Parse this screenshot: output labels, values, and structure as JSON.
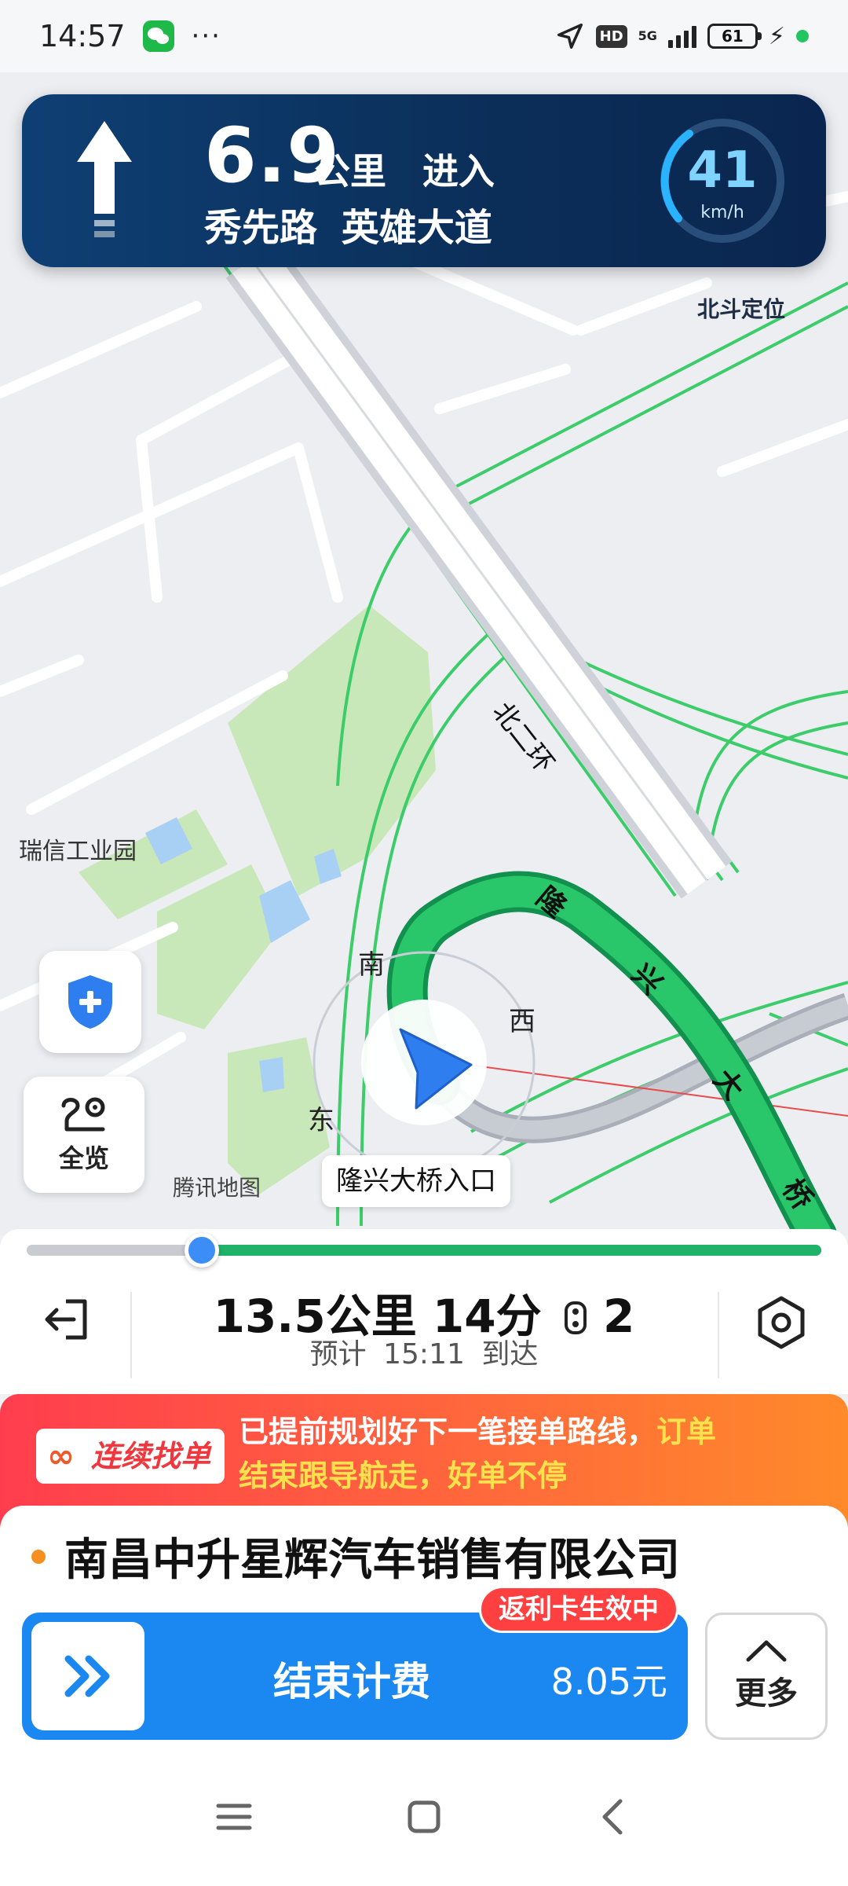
{
  "status_bar": {
    "time": "14:57",
    "more": "···",
    "network_hd": "HD",
    "network_5g": "5G",
    "battery": "61",
    "icons": [
      "wechat-icon",
      "location-arrow-icon",
      "signal-icon",
      "battery-icon",
      "charging-icon"
    ]
  },
  "nav_banner": {
    "distance": "6.9",
    "unit": "公里",
    "action": "进入",
    "roads": "秀先路 英雄大道",
    "speed": "41",
    "speed_unit": "km/h"
  },
  "map": {
    "beidou_label": "北斗定位",
    "place_label": "瑞信工业园",
    "road_north_ring": "北二环",
    "bridge_chars": [
      "隆",
      "兴",
      "大",
      "桥"
    ],
    "dir_south": "南",
    "dir_west": "西",
    "dir_east": "东",
    "watermark": "腾讯地图",
    "entrance_label": "隆兴大桥入口",
    "overview_label": "全览"
  },
  "route": {
    "distance": "13.5公里",
    "duration": "14分",
    "traffic_lights": "2",
    "eta_prefix": "预计",
    "eta_time": "15:11",
    "eta_suffix": "到达",
    "progress": 0.22
  },
  "promo": {
    "badge": "连续找单",
    "text_main": "已提前规划好下一笔接单路线，",
    "text_highlight": "订单",
    "text_line2": "结束跟导航走，好单不停"
  },
  "order": {
    "title": "南昌中升星辉汽车销售有限公司",
    "rebate_badge": "返利卡生效中",
    "end_label": "结束计费",
    "fee": "8.05元",
    "more_label": "更多"
  },
  "colors": {
    "route_green": "#1fb36a",
    "road_outline": "#3ccd6a",
    "banner_bg": "#0b2e58",
    "primary_blue": "#1a88f0",
    "promo_red": "#ff3d4e",
    "promo_orange": "#ff8a2a"
  }
}
